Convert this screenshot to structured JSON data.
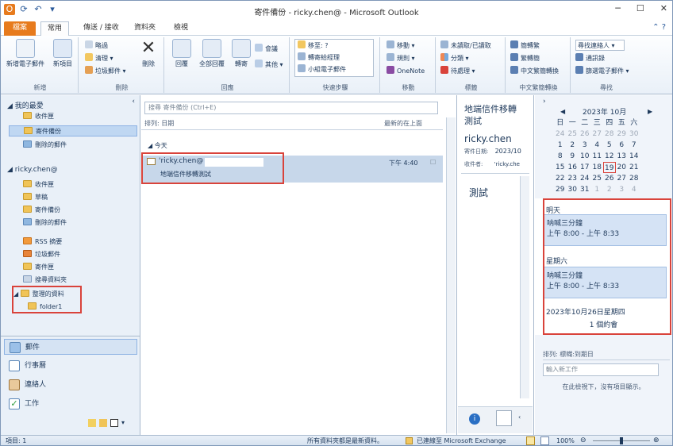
{
  "window": {
    "title": "寄件備份 - ricky.chen@ - Microsoft Outlook"
  },
  "tabs": [
    "檔案",
    "常用",
    "傳送 / 接收",
    "資料夾",
    "檢視"
  ],
  "ribbon": {
    "new_group": {
      "label": "新增",
      "new_mail": "新增電子郵件",
      "new_items": "新項目"
    },
    "delete_group": {
      "label": "刪除",
      "ignore": "略過",
      "clean": "清理",
      "junk": "垃圾郵件",
      "delete": "刪除"
    },
    "respond_group": {
      "label": "回應",
      "reply": "回覆",
      "reply_all": "全部回覆",
      "forward": "轉寄",
      "meeting": "會議",
      "more": "其他"
    },
    "quicksteps_group": {
      "label": "快速步驟",
      "move_to": "移至: ?",
      "to_manager": "轉寄給經理",
      "team_email": "小組電子郵件"
    },
    "move_group": {
      "label": "移動",
      "move": "移動",
      "rules": "規則",
      "onenote": "OneNote"
    },
    "tags_group": {
      "label": "標籤",
      "unread_read": "未讀取/已讀取",
      "categorize": "分類",
      "followup": "待處理"
    },
    "chinese_group": {
      "label": "中文繁簡轉換",
      "to_trad": "簡轉繁",
      "to_simp": "繁轉簡",
      "convert": "中文繁簡轉換"
    },
    "find_group": {
      "label": "尋找",
      "find_contact": "尋找連絡人",
      "address_book": "通訊錄",
      "filter_email": "篩選電子郵件"
    }
  },
  "nav": {
    "favorites_label": "我的最愛",
    "favorites": [
      "收件匣",
      "寄件備份",
      "刪除的郵件"
    ],
    "account_label": "ricky.chen@",
    "folders": [
      "收件匣",
      "草稿",
      "寄件備份",
      "刪除的郵件",
      "RSS 摘要",
      "垃圾郵件",
      "寄件匣",
      "搜尋資料夾"
    ],
    "archive_label": "整理的資料",
    "archive_child": "folder1",
    "bottom": [
      "郵件",
      "行事曆",
      "連絡人",
      "工作"
    ]
  },
  "list": {
    "search_placeholder": "搜尋 寄件備份 (Ctrl+E)",
    "sort_label": "排列: 日期",
    "sort_order": "最新的在上面",
    "group": "今天",
    "mail_to": "'ricky.chen@",
    "mail_subject": "地端信件移轉測試",
    "mail_time": "下午 4:40"
  },
  "reading": {
    "subject_line1": "地端信件移轉",
    "subject_line2": "測試",
    "sender": "ricky.chen",
    "sent_label": "寄件日期:",
    "sent_value": "2023/10",
    "to_label": "收件者:",
    "to_value": "'ricky.che",
    "body": "測試"
  },
  "todo": {
    "month": "2023年 10月",
    "weekdays": [
      "日",
      "一",
      "二",
      "三",
      "四",
      "五",
      "六"
    ],
    "weeks": [
      [
        "24",
        "25",
        "26",
        "27",
        "28",
        "29",
        "30"
      ],
      [
        "1",
        "2",
        "3",
        "4",
        "5",
        "6",
        "7"
      ],
      [
        "8",
        "9",
        "10",
        "11",
        "12",
        "13",
        "14"
      ],
      [
        "15",
        "16",
        "17",
        "18",
        "19",
        "20",
        "21"
      ],
      [
        "22",
        "23",
        "24",
        "25",
        "26",
        "27",
        "28"
      ],
      [
        "29",
        "30",
        "31",
        "1",
        "2",
        "3",
        "4"
      ]
    ],
    "tomorrow_label": "明天",
    "appt1_title": "呐喊三分鐘",
    "appt1_time": "上午 8:00 - 上午 8:33",
    "saturday_label": "星期六",
    "appt2_title": "呐喊三分鐘",
    "appt2_time": "上午 8:00 - 上午 8:33",
    "thursday_label": "2023年10月26日星期四",
    "thursday_count": "1 個約會",
    "tasks_sort": "排列: 標幟:到期日",
    "new_task_placeholder": "輸入新工作",
    "no_items": "在此檢視下，沒有項目顯示。"
  },
  "status": {
    "items": "項目: 1",
    "uptodate": "所有資料夾都是最新資料。",
    "connected": "已連線至 Microsoft Exchange",
    "zoom": "100%"
  }
}
